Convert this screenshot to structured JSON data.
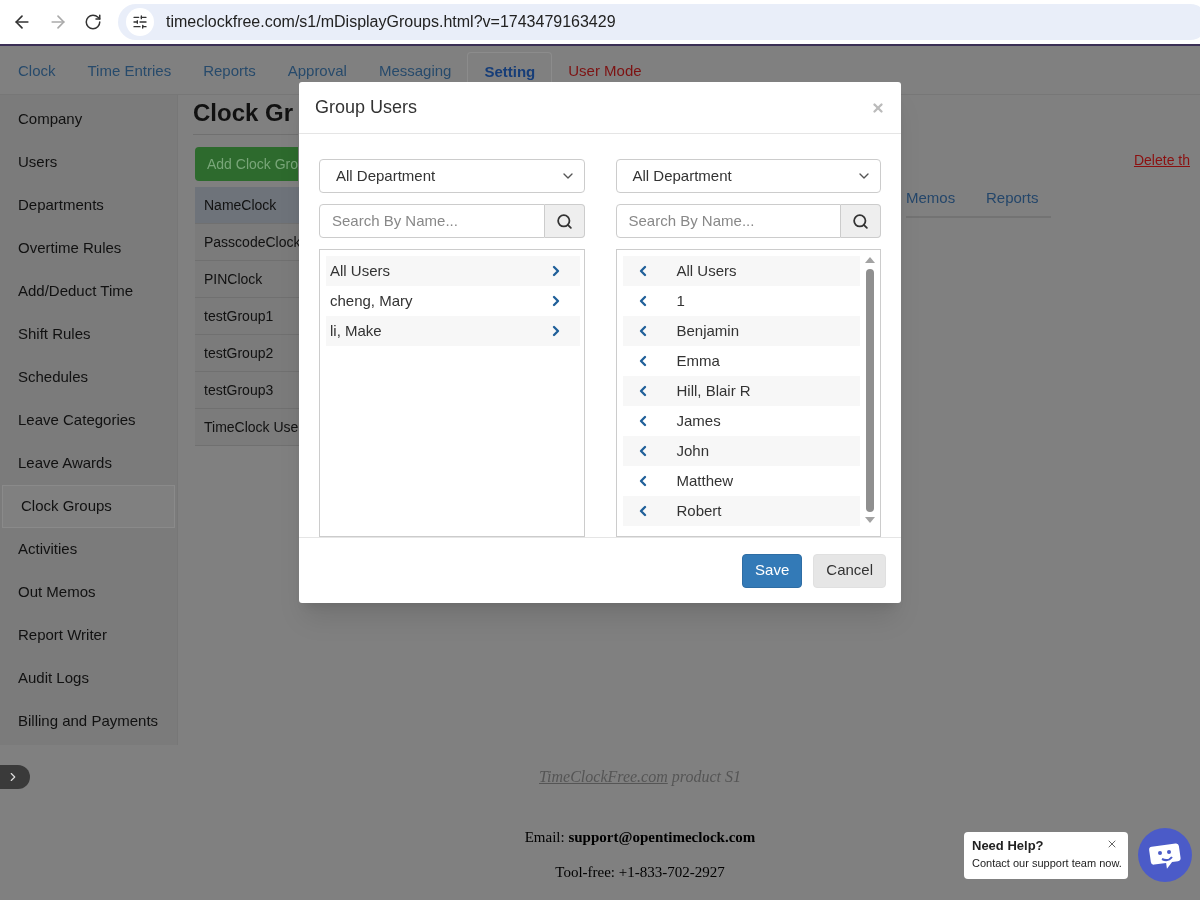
{
  "browser": {
    "url": "timeclockfree.com/s1/mDisplayGroups.html?v=1743479163429"
  },
  "nav": {
    "tabs": [
      {
        "label": "Clock",
        "selected": false,
        "kind": "tab"
      },
      {
        "label": "Time Entries",
        "selected": false,
        "kind": "tab"
      },
      {
        "label": "Reports",
        "selected": false,
        "kind": "tab"
      },
      {
        "label": "Approval",
        "selected": false,
        "kind": "tab"
      },
      {
        "label": "Messaging",
        "selected": false,
        "kind": "tab"
      },
      {
        "label": "Setting",
        "selected": true,
        "kind": "tab"
      },
      {
        "label": "User Mode",
        "selected": false,
        "kind": "mode"
      }
    ]
  },
  "sidebar": {
    "items": [
      {
        "label": "Company",
        "selected": false
      },
      {
        "label": "Users",
        "selected": false
      },
      {
        "label": "Departments",
        "selected": false
      },
      {
        "label": "Overtime Rules",
        "selected": false
      },
      {
        "label": "Add/Deduct Time",
        "selected": false
      },
      {
        "label": "Shift Rules",
        "selected": false
      },
      {
        "label": "Schedules",
        "selected": false
      },
      {
        "label": "Leave Categories",
        "selected": false
      },
      {
        "label": "Leave Awards",
        "selected": false
      },
      {
        "label": "Clock Groups",
        "selected": true
      },
      {
        "label": "Activities",
        "selected": false
      },
      {
        "label": "Out Memos",
        "selected": false
      },
      {
        "label": "Report Writer",
        "selected": false
      },
      {
        "label": "Audit Logs",
        "selected": false
      },
      {
        "label": "Billing and Payments",
        "selected": false
      }
    ]
  },
  "content": {
    "title": "Clock Gr",
    "add_button": "Add Clock Gro",
    "groups": [
      {
        "name": "NameClock",
        "selected": true
      },
      {
        "name": "PasscodeClock",
        "selected": false
      },
      {
        "name": "PINClock",
        "selected": false
      },
      {
        "name": "testGroup1",
        "selected": false
      },
      {
        "name": "testGroup2",
        "selected": false
      },
      {
        "name": "testGroup3",
        "selected": false
      },
      {
        "name": "TimeClock Use",
        "selected": false
      }
    ],
    "delete_link": "Delete th",
    "tabs": [
      "Memos",
      "Reports"
    ]
  },
  "modal": {
    "title": "Group Users",
    "left": {
      "department": "All Department",
      "search_placeholder": "Search By Name...",
      "users": [
        "All Users",
        "cheng, Mary",
        "li, Make"
      ]
    },
    "right": {
      "department": "All Department",
      "search_placeholder": "Search By Name...",
      "users": [
        "All Users",
        "1",
        "Benjamin",
        "Emma",
        "Hill, Blair R",
        "James",
        "John",
        "Matthew",
        "Robert"
      ]
    },
    "buttons": [
      {
        "label": "Save",
        "kind": "primary"
      },
      {
        "label": "Cancel",
        "kind": "default"
      }
    ]
  },
  "footer": {
    "product_link": "TimeClockFree.com",
    "product_suffix": "product S1",
    "email": "Email: **support@opentimeclock.com**",
    "phone": "Tool-free: +1-833-702-2927"
  },
  "chat": {
    "title": "Need Help?",
    "message": "Contact our support team now."
  }
}
